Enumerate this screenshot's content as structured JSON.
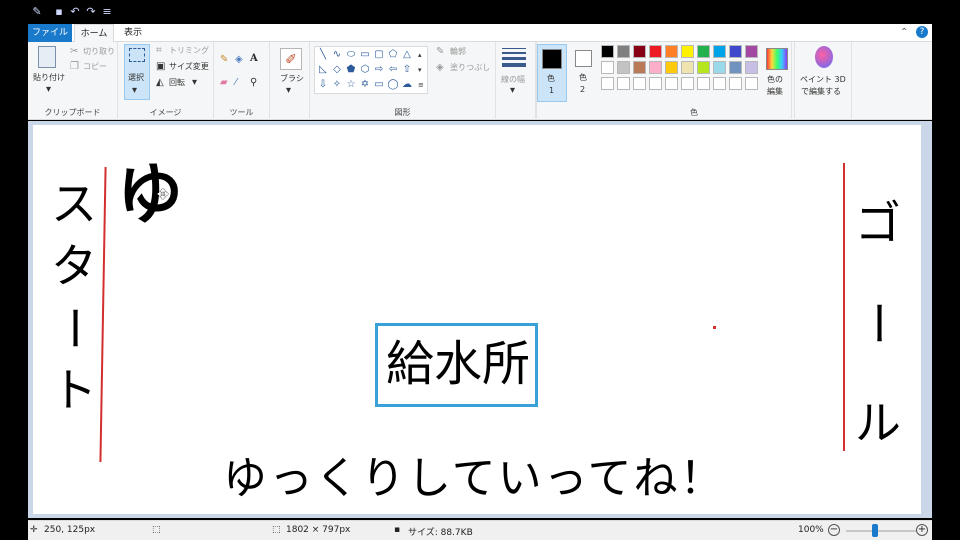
{
  "window": {
    "tabs": [
      {
        "label": "ファイル"
      },
      {
        "label": "ホーム"
      },
      {
        "label": "表示"
      }
    ]
  },
  "ribbon": {
    "clipboard": {
      "label": "クリップボード",
      "paste": "貼り付け",
      "cut": "切り取り",
      "copy": "コピー"
    },
    "image": {
      "label": "イメージ",
      "select": "選択",
      "crop": "トリミング",
      "resize": "サイズ変更",
      "rotate": "回転"
    },
    "tools": {
      "label": "ツール"
    },
    "brush": {
      "label": "ブラシ"
    },
    "shapes": {
      "label": "図形",
      "outline": "輪郭",
      "fill": "塗りつぶし"
    },
    "size": {
      "label": "線の幅"
    },
    "color1": {
      "label": "色",
      "sub": "1"
    },
    "color2": {
      "label": "色",
      "sub": "2"
    },
    "colors": {
      "label": "色"
    },
    "edit_colors": {
      "line1": "色の",
      "line2": "編集"
    },
    "paint3d": {
      "line1": "ペイント 3D",
      "line2": "で編集する"
    },
    "palette_row1": [
      "#000000",
      "#7f7f7f",
      "#880015",
      "#ed1c24",
      "#ff7f27",
      "#fff200",
      "#22b14c",
      "#00a2e8",
      "#3f48cc",
      "#a349a4"
    ],
    "palette_row2": [
      "#ffffff",
      "#c3c3c3",
      "#b97a57",
      "#ffaec9",
      "#ffc90e",
      "#efe4b0",
      "#b5e61d",
      "#99d9ea",
      "#7092be",
      "#c8bfe7"
    ]
  },
  "canvas": {
    "start_chars": [
      "ス",
      "タ",
      "ー",
      "ト"
    ],
    "goal_chars": [
      "ゴ",
      "ー",
      "ル"
    ],
    "yu_char": "ゆ",
    "water_station": "給水所",
    "message": "ゆっくりしていってね！"
  },
  "status": {
    "cursor_pos": "250, 125px",
    "image_size": "1802 × 797px",
    "file_size": "サイズ: 88.7KB",
    "zoom": "100%"
  }
}
